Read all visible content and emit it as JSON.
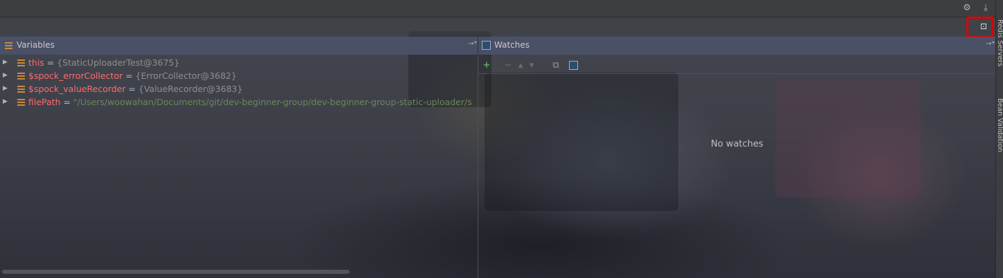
{
  "toolbar": {
    "settings_icon": "gear-icon",
    "hide_icon": "download-icon",
    "restore_layout_icon": "restore-layout-icon"
  },
  "variables": {
    "title": "Variables",
    "items": [
      {
        "name": "this",
        "eq": " = ",
        "value": "{StaticUploaderTest@3675}",
        "kind": "object"
      },
      {
        "name": "$spock_errorCollector",
        "eq": " = ",
        "value": "{ErrorCollector@3682}",
        "kind": "object"
      },
      {
        "name": "$spock_valueRecorder",
        "eq": " = ",
        "value": "{ValueRecorder@3683}",
        "kind": "object"
      },
      {
        "name": "filePath",
        "eq": " = ",
        "value": "\"/Users/woowahan/Documents/git/dev-beginner-group/dev-beginner-group-static-uploader/s",
        "kind": "string"
      }
    ]
  },
  "watches": {
    "title": "Watches",
    "empty_text": "No watches"
  },
  "side_tabs": {
    "redis": "Redis Servers",
    "bean": "Bean Validation"
  },
  "colors": {
    "var_name": "#ff6b6b",
    "string_value": "#6a8759",
    "header_bg": "#4b5269",
    "highlight": "#e00000"
  }
}
